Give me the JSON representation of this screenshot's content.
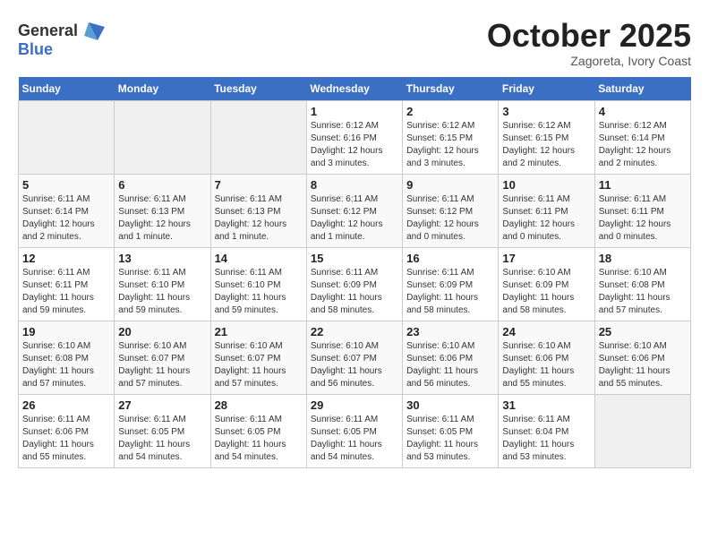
{
  "header": {
    "logo_general": "General",
    "logo_blue": "Blue",
    "month_title": "October 2025",
    "subtitle": "Zagoreta, Ivory Coast"
  },
  "weekdays": [
    "Sunday",
    "Monday",
    "Tuesday",
    "Wednesday",
    "Thursday",
    "Friday",
    "Saturday"
  ],
  "weeks": [
    [
      {
        "day": "",
        "info": ""
      },
      {
        "day": "",
        "info": ""
      },
      {
        "day": "",
        "info": ""
      },
      {
        "day": "1",
        "info": "Sunrise: 6:12 AM\nSunset: 6:16 PM\nDaylight: 12 hours and 3 minutes."
      },
      {
        "day": "2",
        "info": "Sunrise: 6:12 AM\nSunset: 6:15 PM\nDaylight: 12 hours and 3 minutes."
      },
      {
        "day": "3",
        "info": "Sunrise: 6:12 AM\nSunset: 6:15 PM\nDaylight: 12 hours and 2 minutes."
      },
      {
        "day": "4",
        "info": "Sunrise: 6:12 AM\nSunset: 6:14 PM\nDaylight: 12 hours and 2 minutes."
      }
    ],
    [
      {
        "day": "5",
        "info": "Sunrise: 6:11 AM\nSunset: 6:14 PM\nDaylight: 12 hours and 2 minutes."
      },
      {
        "day": "6",
        "info": "Sunrise: 6:11 AM\nSunset: 6:13 PM\nDaylight: 12 hours and 1 minute."
      },
      {
        "day": "7",
        "info": "Sunrise: 6:11 AM\nSunset: 6:13 PM\nDaylight: 12 hours and 1 minute."
      },
      {
        "day": "8",
        "info": "Sunrise: 6:11 AM\nSunset: 6:12 PM\nDaylight: 12 hours and 1 minute."
      },
      {
        "day": "9",
        "info": "Sunrise: 6:11 AM\nSunset: 6:12 PM\nDaylight: 12 hours and 0 minutes."
      },
      {
        "day": "10",
        "info": "Sunrise: 6:11 AM\nSunset: 6:11 PM\nDaylight: 12 hours and 0 minutes."
      },
      {
        "day": "11",
        "info": "Sunrise: 6:11 AM\nSunset: 6:11 PM\nDaylight: 12 hours and 0 minutes."
      }
    ],
    [
      {
        "day": "12",
        "info": "Sunrise: 6:11 AM\nSunset: 6:11 PM\nDaylight: 11 hours and 59 minutes."
      },
      {
        "day": "13",
        "info": "Sunrise: 6:11 AM\nSunset: 6:10 PM\nDaylight: 11 hours and 59 minutes."
      },
      {
        "day": "14",
        "info": "Sunrise: 6:11 AM\nSunset: 6:10 PM\nDaylight: 11 hours and 59 minutes."
      },
      {
        "day": "15",
        "info": "Sunrise: 6:11 AM\nSunset: 6:09 PM\nDaylight: 11 hours and 58 minutes."
      },
      {
        "day": "16",
        "info": "Sunrise: 6:11 AM\nSunset: 6:09 PM\nDaylight: 11 hours and 58 minutes."
      },
      {
        "day": "17",
        "info": "Sunrise: 6:10 AM\nSunset: 6:09 PM\nDaylight: 11 hours and 58 minutes."
      },
      {
        "day": "18",
        "info": "Sunrise: 6:10 AM\nSunset: 6:08 PM\nDaylight: 11 hours and 57 minutes."
      }
    ],
    [
      {
        "day": "19",
        "info": "Sunrise: 6:10 AM\nSunset: 6:08 PM\nDaylight: 11 hours and 57 minutes."
      },
      {
        "day": "20",
        "info": "Sunrise: 6:10 AM\nSunset: 6:07 PM\nDaylight: 11 hours and 57 minutes."
      },
      {
        "day": "21",
        "info": "Sunrise: 6:10 AM\nSunset: 6:07 PM\nDaylight: 11 hours and 57 minutes."
      },
      {
        "day": "22",
        "info": "Sunrise: 6:10 AM\nSunset: 6:07 PM\nDaylight: 11 hours and 56 minutes."
      },
      {
        "day": "23",
        "info": "Sunrise: 6:10 AM\nSunset: 6:06 PM\nDaylight: 11 hours and 56 minutes."
      },
      {
        "day": "24",
        "info": "Sunrise: 6:10 AM\nSunset: 6:06 PM\nDaylight: 11 hours and 55 minutes."
      },
      {
        "day": "25",
        "info": "Sunrise: 6:10 AM\nSunset: 6:06 PM\nDaylight: 11 hours and 55 minutes."
      }
    ],
    [
      {
        "day": "26",
        "info": "Sunrise: 6:11 AM\nSunset: 6:06 PM\nDaylight: 11 hours and 55 minutes."
      },
      {
        "day": "27",
        "info": "Sunrise: 6:11 AM\nSunset: 6:05 PM\nDaylight: 11 hours and 54 minutes."
      },
      {
        "day": "28",
        "info": "Sunrise: 6:11 AM\nSunset: 6:05 PM\nDaylight: 11 hours and 54 minutes."
      },
      {
        "day": "29",
        "info": "Sunrise: 6:11 AM\nSunset: 6:05 PM\nDaylight: 11 hours and 54 minutes."
      },
      {
        "day": "30",
        "info": "Sunrise: 6:11 AM\nSunset: 6:05 PM\nDaylight: 11 hours and 53 minutes."
      },
      {
        "day": "31",
        "info": "Sunrise: 6:11 AM\nSunset: 6:04 PM\nDaylight: 11 hours and 53 minutes."
      },
      {
        "day": "",
        "info": ""
      }
    ]
  ]
}
